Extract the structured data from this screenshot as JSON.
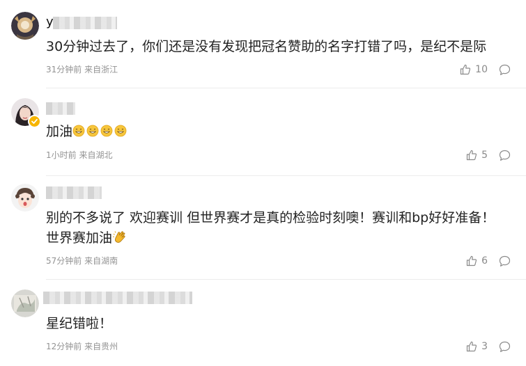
{
  "comments": [
    {
      "username": "y",
      "text": "30分钟过去了，你们还是没有发现把冠名赞助的名字打错了吗，是纪不是际",
      "time": "31分钟前",
      "location": "来自浙江",
      "likes": "10"
    },
    {
      "username": "",
      "text": "加油",
      "emoji": [
        "grin-emoji",
        "grin-emoji",
        "grin-emoji",
        "grin-emoji"
      ],
      "time": "1小时前",
      "location": "来自湖北",
      "likes": "5"
    },
    {
      "username": "",
      "text": "别的不多说了 欢迎赛训 但世界赛才是真的检验时刻噢！赛训和bp好好准备！世界赛加油",
      "emoji": [
        "clap-emoji"
      ],
      "time": "57分钟前",
      "location": "来自湖南",
      "likes": "6"
    },
    {
      "username": "",
      "text": "星纪错啦！",
      "time": "12分钟前",
      "location": "来自贵州",
      "likes": "3"
    }
  ],
  "icons": {
    "like": "thumbs-up-icon",
    "reply": "comment-bubble-icon",
    "verified": "verified-badge-icon"
  },
  "colors": {
    "verified": "#f7b500",
    "meta": "#939393",
    "text": "#222222"
  }
}
